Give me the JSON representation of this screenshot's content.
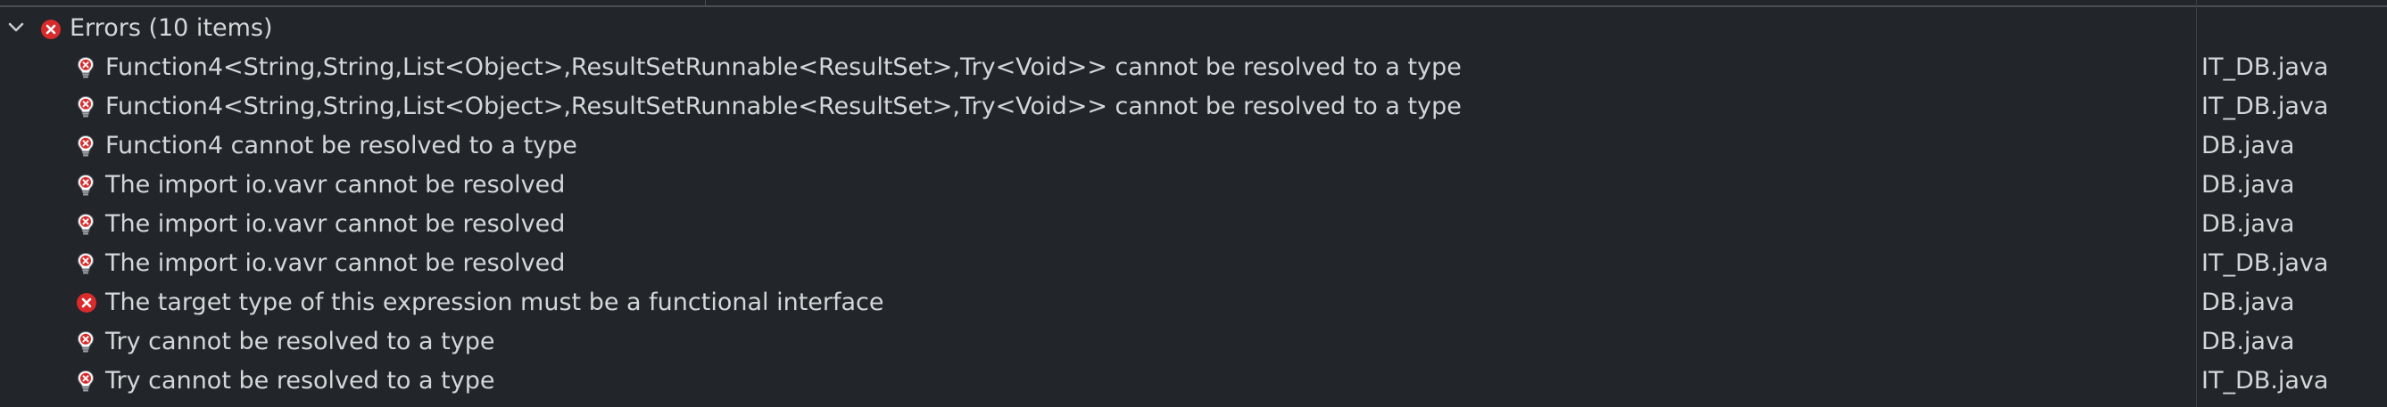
{
  "group": {
    "label": "Errors (10 items)"
  },
  "items": [
    {
      "icon": "lightbulb-error-icon",
      "description": "Function4<String,String,List<Object>,ResultSetRunnable<ResultSet>,Try<Void>> cannot be resolved to a type",
      "resource": "IT_DB.java"
    },
    {
      "icon": "lightbulb-error-icon",
      "description": "Function4<String,String,List<Object>,ResultSetRunnable<ResultSet>,Try<Void>> cannot be resolved to a type",
      "resource": "IT_DB.java"
    },
    {
      "icon": "lightbulb-error-icon",
      "description": "Function4 cannot be resolved to a type",
      "resource": "DB.java"
    },
    {
      "icon": "lightbulb-error-icon",
      "description": "The import io.vavr cannot be resolved",
      "resource": "DB.java"
    },
    {
      "icon": "lightbulb-error-icon",
      "description": "The import io.vavr cannot be resolved",
      "resource": "DB.java"
    },
    {
      "icon": "lightbulb-error-icon",
      "description": "The import io.vavr cannot be resolved",
      "resource": "IT_DB.java"
    },
    {
      "icon": "error-icon",
      "description": "The target type of this expression must be a functional interface",
      "resource": "DB.java"
    },
    {
      "icon": "lightbulb-error-icon",
      "description": "Try cannot be resolved to a type",
      "resource": "DB.java"
    },
    {
      "icon": "lightbulb-error-icon",
      "description": "Try cannot be resolved to a type",
      "resource": "IT_DB.java"
    }
  ],
  "colors": {
    "background": "#22262a",
    "text": "#d4d7da",
    "error_red": "#d92b2b"
  }
}
